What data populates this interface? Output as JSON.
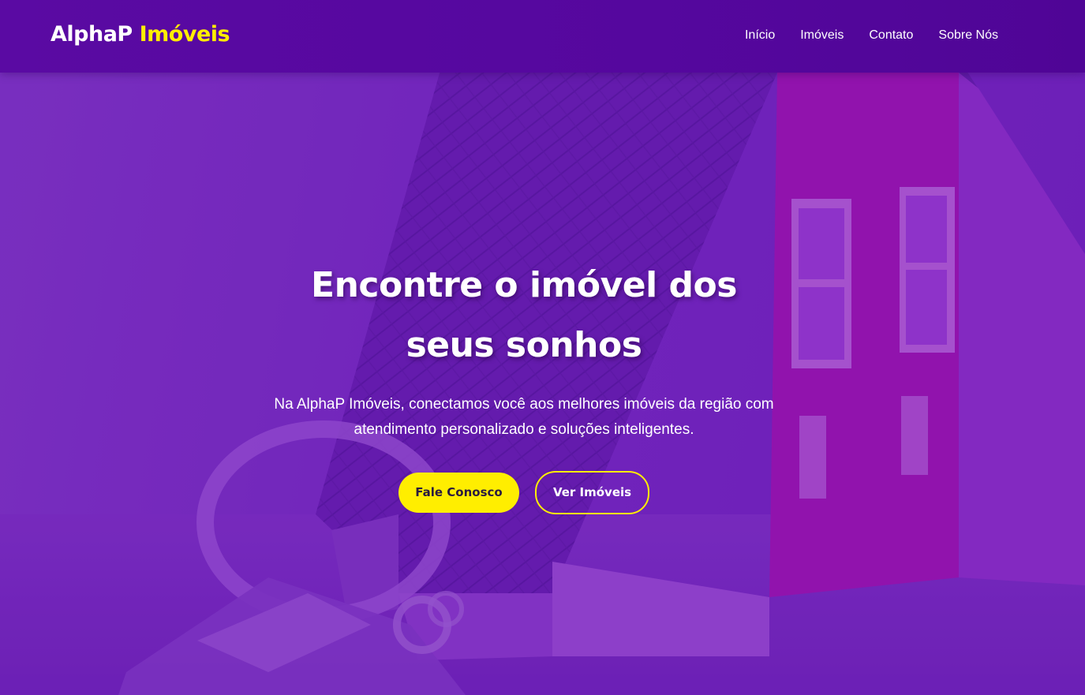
{
  "header": {
    "logo_main": "AlphaP",
    "logo_accent": "Imóveis",
    "nav": [
      {
        "label": "Início"
      },
      {
        "label": "Imóveis"
      },
      {
        "label": "Contato"
      },
      {
        "label": "Sobre Nós"
      }
    ]
  },
  "hero": {
    "title": "Encontre o imóvel dos seus sonhos",
    "subtitle": "Na AlphaP Imóveis, conectamos você aos melhores imóveis da região com atendimento personalizado e soluções inteligentes.",
    "primary_button": "Fale Conosco",
    "secondary_button": "Ver Imóveis"
  },
  "colors": {
    "header_bg": "#55079e",
    "hero_tint": "#7228bd",
    "accent": "#ffee00",
    "text": "#ffffff"
  }
}
